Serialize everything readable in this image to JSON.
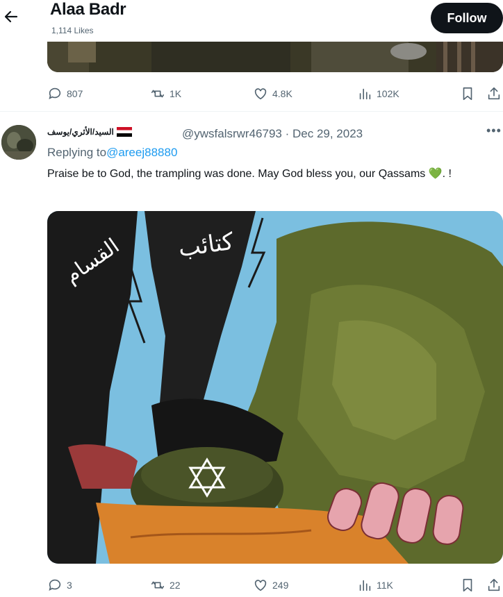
{
  "header": {
    "name": "Alaa Badr",
    "likes": "1,114 Likes",
    "follow_label": "Follow"
  },
  "top_actions": {
    "replies": "807",
    "reposts": "1K",
    "likes": "4.8K",
    "views": "102K"
  },
  "reply": {
    "display_name": "السيد/الأثري/يوسف",
    "handle": "@ywsfalsrwr46793",
    "date": "Dec 29, 2023",
    "replying_prefix": "Replying to",
    "replying_to": "@areej88880",
    "text": "Praise be to God, the trampling was done. May God bless you, our Qassams 💚. !",
    "image_text_1": "كتائب",
    "image_text_2": "القسام",
    "actions": {
      "replies": "3",
      "reposts": "22",
      "likes": "249",
      "views": "11K"
    }
  }
}
